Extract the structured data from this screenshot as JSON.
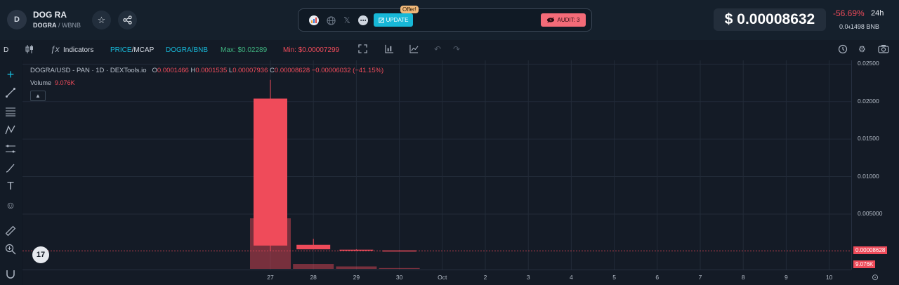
{
  "token": {
    "avatar_letter": "D",
    "name": "DOG RA",
    "symbol": "DOGRA",
    "quote": "WBNB"
  },
  "header": {
    "offer_label": "Offer!",
    "update_label": "UPDATE",
    "audit_label": "AUDIT: 3",
    "price": "$ 0.00008632",
    "change": "-56.69%",
    "timeframe": "24h",
    "bnb_prefix": "0.0",
    "bnb_sub": "4",
    "bnb_digits": "1498",
    "bnb_unit": "BNB"
  },
  "toolbar": {
    "interval": "D",
    "indicators": "Indicators",
    "price_label": "PRICE",
    "mcap_label": "/MCAP",
    "pair_quote_left": "DOGRA/",
    "pair_quote_right": "BNB",
    "max_label": "Max: $0.02289",
    "min_label": "Min: $0.00007299"
  },
  "legend": {
    "title": "DOGRA/USD - PAN · 1D · DEXTools.io",
    "o_label": "O",
    "o_val": "0.0001466",
    "h_label": "H",
    "h_val": "0.0001535",
    "l_label": "L",
    "l_val": "0.00007936",
    "c_label": "C",
    "c_val": "0.00008628",
    "chg": "−0.00006032 (−41.15%)",
    "volume_label": "Volume",
    "volume_val": "9.076K",
    "tv_logo": "17"
  },
  "colors": {
    "down": "#ef4b5a",
    "bg": "#141b26",
    "grid": "#222b38"
  },
  "chart_data": {
    "type": "candlestick",
    "title": "DOGRA/USD - PAN · 1D · DEXTools.io",
    "ylim": [
      -0.0024,
      0.0255
    ],
    "y_ticks": [
      "0.02500",
      "0.02000",
      "0.01500",
      "0.01000",
      "0.005000"
    ],
    "y_tick_values": [
      0.025,
      0.02,
      0.015,
      0.01,
      0.005
    ],
    "x_ticks": [
      "27",
      "28",
      "29",
      "30",
      "Oct",
      "2",
      "3",
      "4",
      "5",
      "6",
      "7",
      "8",
      "9",
      "10"
    ],
    "last_price_label": "0.00008628",
    "last_volume_label": "9.076K",
    "candles": [
      {
        "x": "27",
        "open": 0.0204,
        "high": 0.0229,
        "low": 0.0001,
        "close": 0.0008,
        "volume": 0.62
      },
      {
        "x": "28",
        "open": 0.0009,
        "high": 0.0017,
        "low": 0.0003,
        "close": 0.0003,
        "volume": 0.06
      },
      {
        "x": "29",
        "open": 0.00025,
        "high": 0.0003,
        "low": 0.0001,
        "close": 0.00015,
        "volume": 0.03
      },
      {
        "x": "30",
        "open": 0.0001466,
        "high": 0.0001535,
        "low": 7.936e-05,
        "close": 8.628e-05,
        "volume": 0.01
      }
    ]
  }
}
